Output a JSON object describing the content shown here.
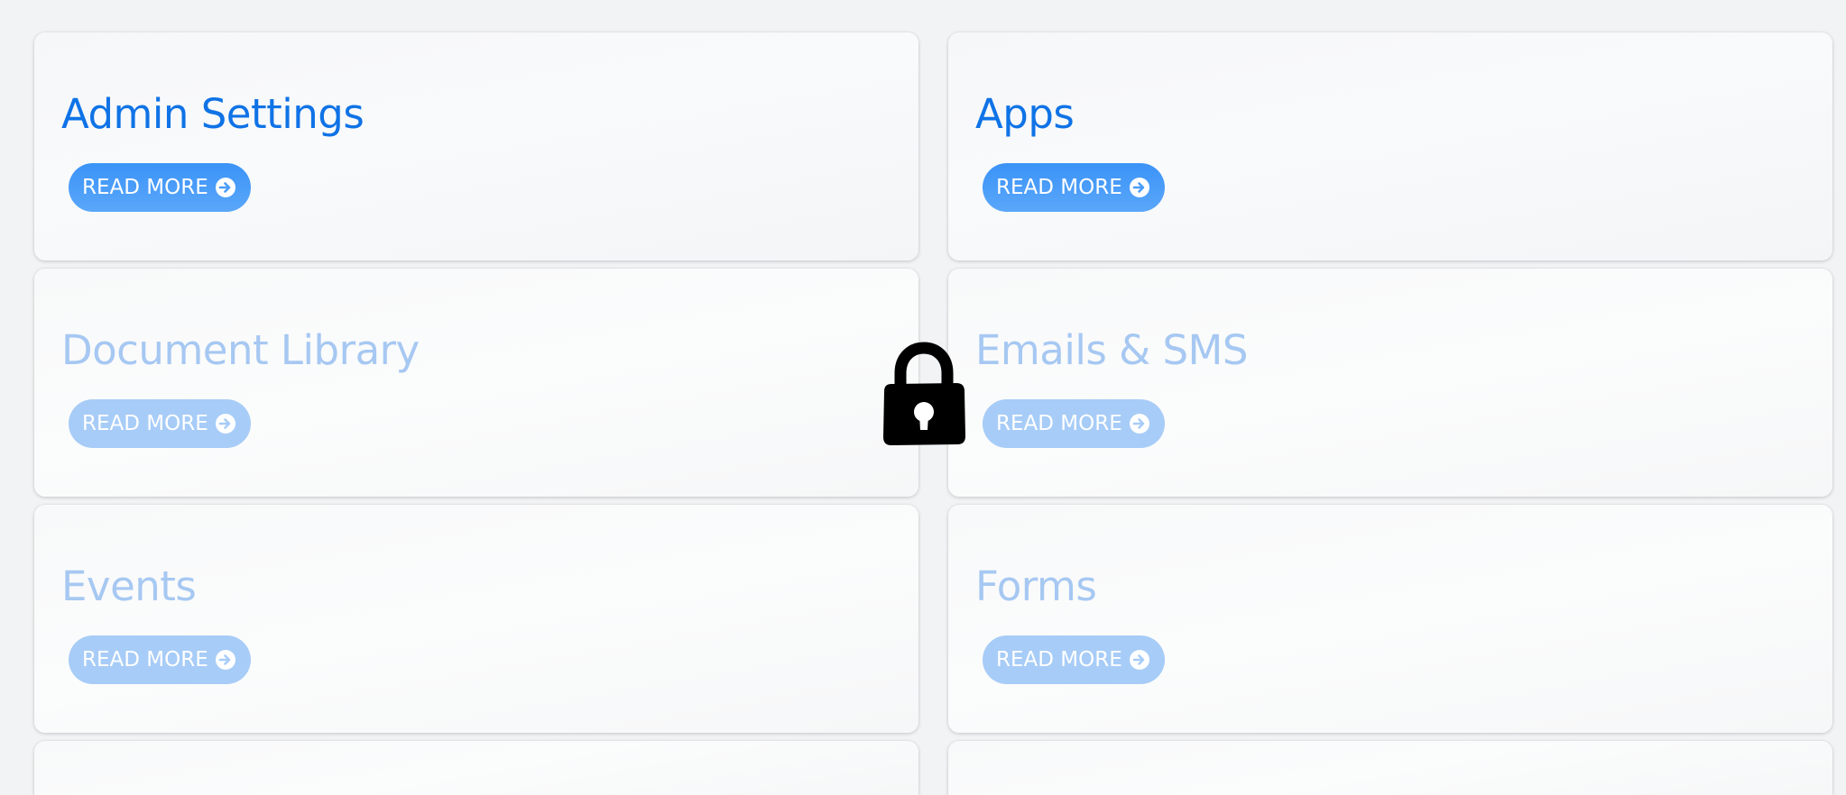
{
  "cards": [
    {
      "title": "Admin Settings",
      "button_label": "READ MORE",
      "locked": false
    },
    {
      "title": "Apps",
      "button_label": "READ MORE",
      "locked": false
    },
    {
      "title": "Document Library",
      "button_label": "READ MORE",
      "locked": true
    },
    {
      "title": "Emails & SMS",
      "button_label": "READ MORE",
      "locked": true
    },
    {
      "title": "Events",
      "button_label": "READ MORE",
      "locked": true
    },
    {
      "title": "Forms",
      "button_label": "READ MORE",
      "locked": true
    }
  ],
  "icons": {
    "button_icon": "arrow-right-circle-icon",
    "overlay_icon": "lock-icon"
  },
  "colors": {
    "page_background": "#f1f3f5",
    "title_active": "#0f73e6",
    "title_locked": "#a6c8f2",
    "button_active": "#4a9df8",
    "button_locked": "#a7ccf7",
    "lock": "#000000"
  }
}
